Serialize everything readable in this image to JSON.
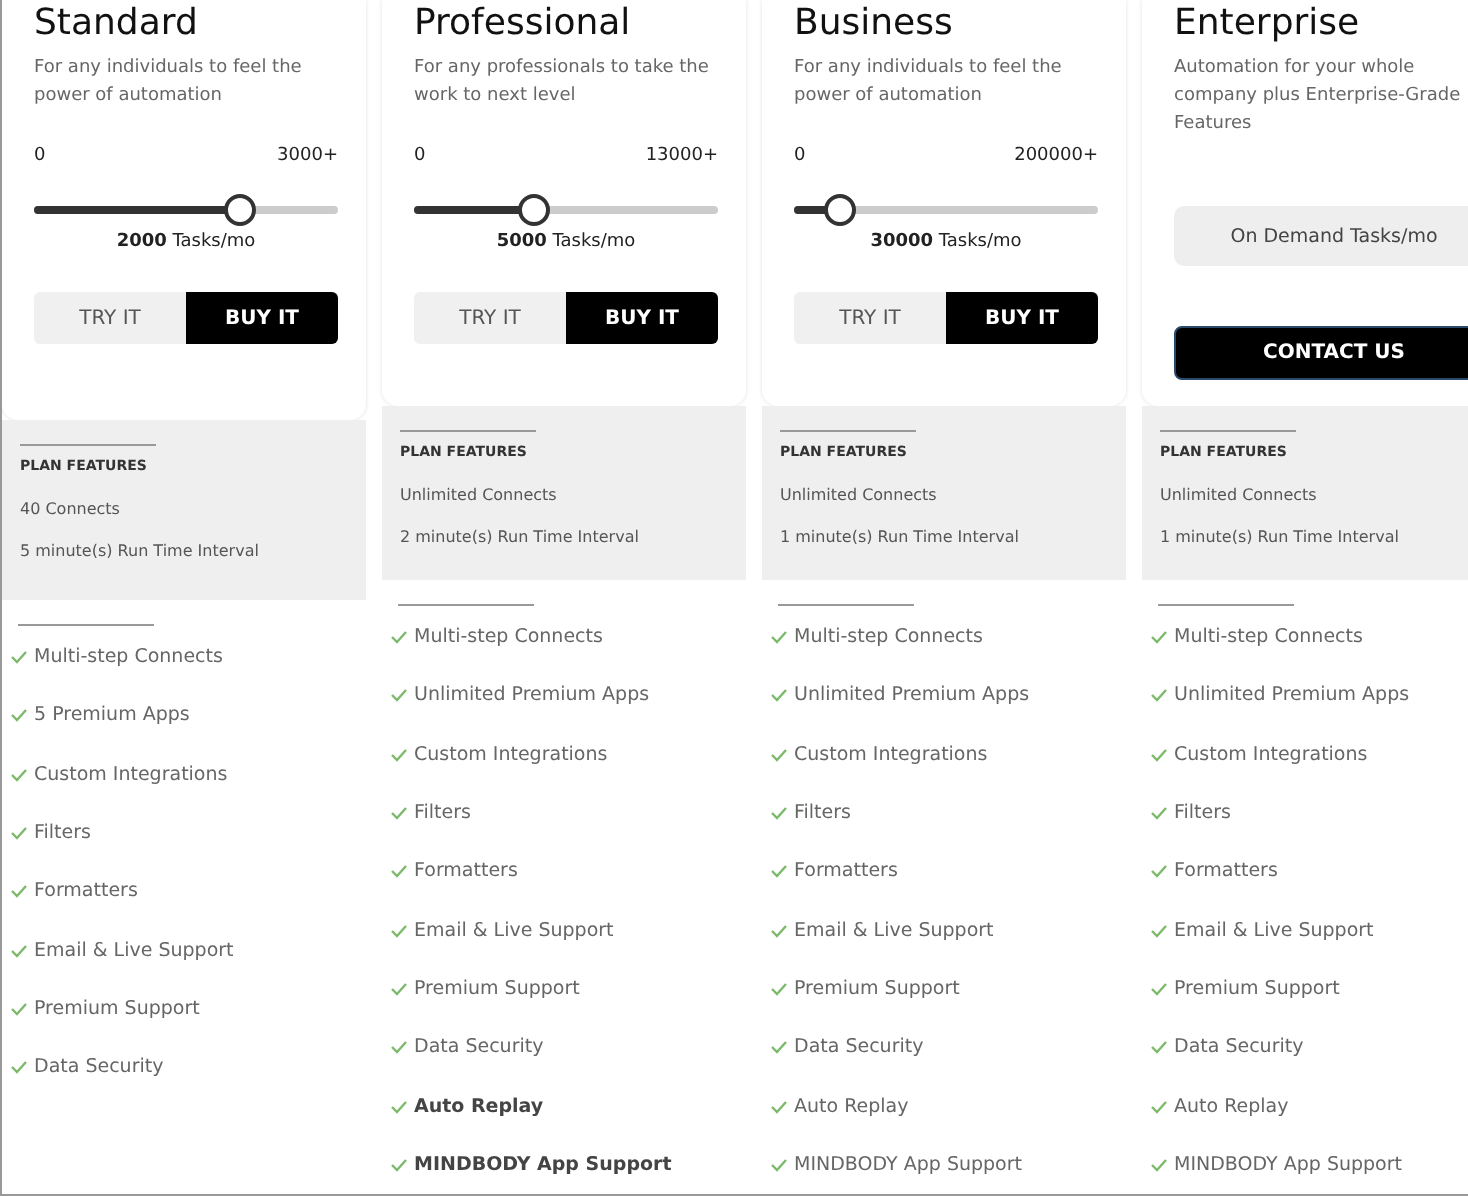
{
  "tiers": [
    {
      "name": "Standard",
      "description": "For any individuals to feel the power of automation",
      "usage": {
        "kind": "slider",
        "min_label": "0",
        "max_label": "3000+",
        "level": 0.67,
        "amount": "2000",
        "unit": "Tasks/mo"
      },
      "buttons": [
        {
          "label": "TRY IT",
          "kind": "secondary"
        },
        {
          "label": "BUY IT",
          "kind": "primary"
        }
      ],
      "plan_features": {
        "heading": "PLAN FEATURES",
        "items": [
          "40 Connects",
          "5 minute(s) Run Time Interval"
        ]
      },
      "features": [
        {
          "text": "Multi-step Connects",
          "bold": false
        },
        {
          "text": "5 Premium Apps",
          "bold": false
        },
        {
          "text": "Custom Integrations",
          "bold": false
        },
        {
          "text": "Filters",
          "bold": false
        },
        {
          "text": "Formatters",
          "bold": false
        },
        {
          "text": "Email & Live Support",
          "bold": false
        },
        {
          "text": "Premium Support",
          "bold": false
        },
        {
          "text": "Data Security",
          "bold": false
        }
      ]
    },
    {
      "name": "Professional",
      "description": "For any professionals to take the work to next level",
      "usage": {
        "kind": "slider",
        "min_label": "0",
        "max_label": "13000+",
        "level": 0.39,
        "amount": "5000",
        "unit": "Tasks/mo"
      },
      "buttons": [
        {
          "label": "TRY IT",
          "kind": "secondary"
        },
        {
          "label": "BUY IT",
          "kind": "primary"
        }
      ],
      "plan_features": {
        "heading": "PLAN FEATURES",
        "items": [
          "Unlimited Connects",
          "2 minute(s) Run Time Interval"
        ]
      },
      "features": [
        {
          "text": "Multi-step Connects",
          "bold": false
        },
        {
          "text": "Unlimited Premium Apps",
          "bold": false
        },
        {
          "text": "Custom Integrations",
          "bold": false
        },
        {
          "text": "Filters",
          "bold": false
        },
        {
          "text": "Formatters",
          "bold": false
        },
        {
          "text": "Email & Live Support",
          "bold": false
        },
        {
          "text": "Premium Support",
          "bold": false
        },
        {
          "text": "Data Security",
          "bold": false
        },
        {
          "text": "Auto Replay",
          "bold": true
        },
        {
          "text": "MINDBODY App Support",
          "bold": true
        }
      ]
    },
    {
      "name": "Business",
      "description": "For any individuals to feel the power of automation",
      "usage": {
        "kind": "slider",
        "min_label": "0",
        "max_label": "200000+",
        "level": 0.145,
        "amount": "30000",
        "unit": "Tasks/mo"
      },
      "buttons": [
        {
          "label": "TRY IT",
          "kind": "secondary"
        },
        {
          "label": "BUY IT",
          "kind": "primary"
        }
      ],
      "plan_features": {
        "heading": "PLAN FEATURES",
        "items": [
          "Unlimited Connects",
          "1 minute(s) Run Time Interval"
        ]
      },
      "features": [
        {
          "text": "Multi-step Connects",
          "bold": false
        },
        {
          "text": "Unlimited Premium Apps",
          "bold": false
        },
        {
          "text": "Custom Integrations",
          "bold": false
        },
        {
          "text": "Filters",
          "bold": false
        },
        {
          "text": "Formatters",
          "bold": false
        },
        {
          "text": "Email & Live Support",
          "bold": false
        },
        {
          "text": "Premium Support",
          "bold": false
        },
        {
          "text": "Data Security",
          "bold": false
        },
        {
          "text": "Auto Replay",
          "bold": false
        },
        {
          "text": "MINDBODY App Support",
          "bold": false
        }
      ]
    },
    {
      "name": "Enterprise",
      "description": "Automation for your whole company plus Enterprise-Grade Features",
      "usage": {
        "kind": "on_demand",
        "label": "On Demand Tasks/mo"
      },
      "buttons": [
        {
          "label": "CONTACT US",
          "kind": "wide"
        }
      ],
      "plan_features": {
        "heading": "PLAN FEATURES",
        "items": [
          "Unlimited Connects",
          "1 minute(s) Run Time Interval"
        ]
      },
      "features": [
        {
          "text": "Multi-step Connects",
          "bold": false
        },
        {
          "text": "Unlimited Premium Apps",
          "bold": false
        },
        {
          "text": "Custom Integrations",
          "bold": false
        },
        {
          "text": "Filters",
          "bold": false
        },
        {
          "text": "Formatters",
          "bold": false
        },
        {
          "text": "Email & Live Support",
          "bold": false
        },
        {
          "text": "Premium Support",
          "bold": false
        },
        {
          "text": "Data Security",
          "bold": false
        },
        {
          "text": "Auto Replay",
          "bold": false
        },
        {
          "text": "MINDBODY App Support",
          "bold": false
        }
      ]
    }
  ]
}
